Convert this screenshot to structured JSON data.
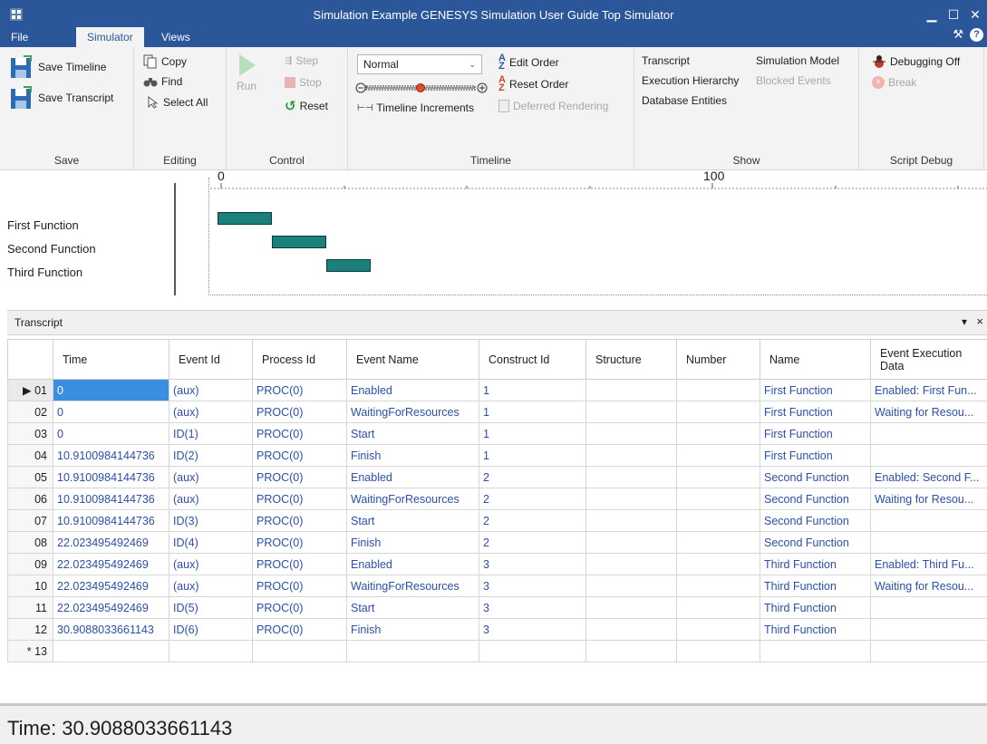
{
  "window": {
    "title": "Simulation Example GENESYS Simulation User Guide Top Simulator",
    "accent_color": "#2b579a"
  },
  "tabs": [
    {
      "label": "File"
    },
    {
      "label": "Simulator"
    },
    {
      "label": "Views"
    }
  ],
  "ribbon": {
    "save": {
      "label": "Save",
      "save_timeline": "Save Timeline",
      "save_transcript": "Save Transcript"
    },
    "editing": {
      "label": "Editing",
      "copy": "Copy",
      "find": "Find",
      "select_all": "Select All"
    },
    "control": {
      "label": "Control",
      "run": "Run",
      "step": "Step",
      "stop": "Stop",
      "reset": "Reset"
    },
    "timeline": {
      "label": "Timeline",
      "speed_value": "Normal",
      "timeline_increments": "Timeline Increments",
      "edit_order": "Edit Order",
      "reset_order": "Reset Order",
      "deferred_rendering": "Deferred Rendering"
    },
    "show": {
      "label": "Show",
      "transcript": "Transcript",
      "simulation_model": "Simulation Model",
      "execution_hierarchy": "Execution Hierarchy",
      "blocked_events": "Blocked Events",
      "database_entities": "Database Entities"
    },
    "script_debug": {
      "label": "Script Debug",
      "debugging_off": "Debugging Off",
      "break": "Break"
    }
  },
  "timeline_view": {
    "tick_0": "0",
    "tick_100": "100",
    "functions": [
      {
        "label": "First Function",
        "start": 0,
        "finish": 10.9100984144736
      },
      {
        "label": "Second Function",
        "start": 10.9100984144736,
        "finish": 22.023495492469
      },
      {
        "label": "Third Function",
        "start": 22.023495492469,
        "finish": 30.9088033661143
      }
    ],
    "bar_color": "#1b8079"
  },
  "transcript": {
    "title": "Transcript",
    "pin_icon": "▾",
    "close_icon": "×",
    "columns": [
      "",
      "Time",
      "Event Id",
      "Process Id",
      "Event Name",
      "Construct Id",
      "Structure",
      "Number",
      "Name",
      "Event Execution Data"
    ],
    "rows": [
      {
        "num": "01",
        "time": "0",
        "event_id": "(aux)",
        "process_id": "PROC(0)",
        "event_name": "Enabled",
        "construct_id": "1",
        "structure": "",
        "number": "",
        "name": "First Function",
        "exec_data": "Enabled: First Fun..."
      },
      {
        "num": "02",
        "time": "0",
        "event_id": "(aux)",
        "process_id": "PROC(0)",
        "event_name": "WaitingForResources",
        "construct_id": "1",
        "structure": "",
        "number": "",
        "name": "First Function",
        "exec_data": "Waiting for Resou..."
      },
      {
        "num": "03",
        "time": "0",
        "event_id": "ID(1)",
        "process_id": "PROC(0)",
        "event_name": "Start",
        "construct_id": "1",
        "structure": "",
        "number": "",
        "name": "First Function",
        "exec_data": ""
      },
      {
        "num": "04",
        "time": "10.9100984144736",
        "event_id": "ID(2)",
        "process_id": "PROC(0)",
        "event_name": "Finish",
        "construct_id": "1",
        "structure": "",
        "number": "",
        "name": "First Function",
        "exec_data": ""
      },
      {
        "num": "05",
        "time": "10.9100984144736",
        "event_id": "(aux)",
        "process_id": "PROC(0)",
        "event_name": "Enabled",
        "construct_id": "2",
        "structure": "",
        "number": "",
        "name": "Second Function",
        "exec_data": "Enabled: Second F..."
      },
      {
        "num": "06",
        "time": "10.9100984144736",
        "event_id": "(aux)",
        "process_id": "PROC(0)",
        "event_name": "WaitingForResources",
        "construct_id": "2",
        "structure": "",
        "number": "",
        "name": "Second Function",
        "exec_data": "Waiting for Resou..."
      },
      {
        "num": "07",
        "time": "10.9100984144736",
        "event_id": "ID(3)",
        "process_id": "PROC(0)",
        "event_name": "Start",
        "construct_id": "2",
        "structure": "",
        "number": "",
        "name": "Second Function",
        "exec_data": ""
      },
      {
        "num": "08",
        "time": "22.023495492469",
        "event_id": "ID(4)",
        "process_id": "PROC(0)",
        "event_name": "Finish",
        "construct_id": "2",
        "structure": "",
        "number": "",
        "name": "Second Function",
        "exec_data": ""
      },
      {
        "num": "09",
        "time": "22.023495492469",
        "event_id": "(aux)",
        "process_id": "PROC(0)",
        "event_name": "Enabled",
        "construct_id": "3",
        "structure": "",
        "number": "",
        "name": "Third Function",
        "exec_data": "Enabled: Third Fu..."
      },
      {
        "num": "10",
        "time": "22.023495492469",
        "event_id": "(aux)",
        "process_id": "PROC(0)",
        "event_name": "WaitingForResources",
        "construct_id": "3",
        "structure": "",
        "number": "",
        "name": "Third Function",
        "exec_data": "Waiting for Resou..."
      },
      {
        "num": "11",
        "time": "22.023495492469",
        "event_id": "ID(5)",
        "process_id": "PROC(0)",
        "event_name": "Start",
        "construct_id": "3",
        "structure": "",
        "number": "",
        "name": "Third Function",
        "exec_data": ""
      },
      {
        "num": "12",
        "time": "30.9088033661143",
        "event_id": "ID(6)",
        "process_id": "PROC(0)",
        "event_name": "Finish",
        "construct_id": "3",
        "structure": "",
        "number": "",
        "name": "Third Function",
        "exec_data": ""
      }
    ],
    "new_row_num": "13",
    "selected_marker": "▶",
    "new_row_marker": "*"
  },
  "status": {
    "text": "Time: 30.9088033661143"
  }
}
